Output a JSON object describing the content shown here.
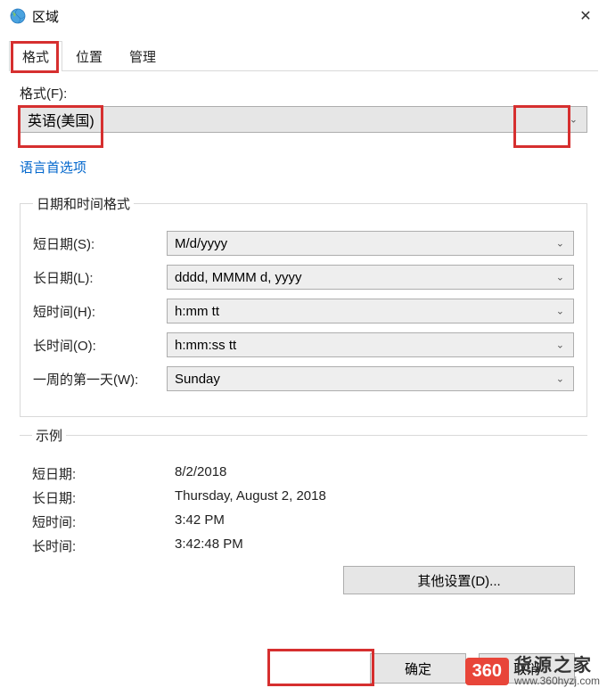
{
  "window": {
    "title": "区域",
    "close_glyph": "✕"
  },
  "tabs": {
    "format": "格式",
    "location": "位置",
    "admin": "管理"
  },
  "format": {
    "label": "格式(F):",
    "value": "英语(美国)"
  },
  "link": {
    "language_prefs": "语言首选项"
  },
  "datetime_group": {
    "legend": "日期和时间格式",
    "short_date_label": "短日期(S):",
    "short_date_value": "M/d/yyyy",
    "long_date_label": "长日期(L):",
    "long_date_value": "dddd, MMMM d, yyyy",
    "short_time_label": "短时间(H):",
    "short_time_value": "h:mm tt",
    "long_time_label": "长时间(O):",
    "long_time_value": "h:mm:ss tt",
    "first_day_label": "一周的第一天(W):",
    "first_day_value": "Sunday"
  },
  "example_group": {
    "legend": "示例",
    "short_date_label": "短日期:",
    "short_date_value": "8/2/2018",
    "long_date_label": "长日期:",
    "long_date_value": "Thursday, August 2, 2018",
    "short_time_label": "短时间:",
    "short_time_value": "3:42 PM",
    "long_time_label": "长时间:",
    "long_time_value": "3:42:48 PM"
  },
  "buttons": {
    "additional": "其他设置(D)...",
    "ok": "确定",
    "cancel": "取消"
  },
  "watermark": {
    "badge": "360",
    "line1": "货源之家",
    "line2": "www.360hyzj.com"
  }
}
